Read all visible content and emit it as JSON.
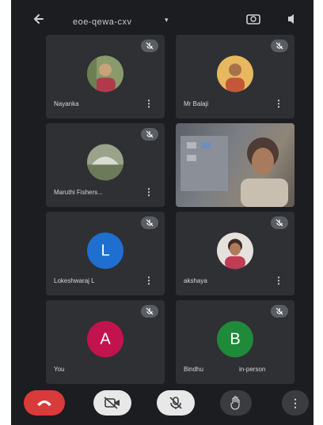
{
  "header": {
    "meeting_code": "eoe-qewa-cxv",
    "caret": "▾"
  },
  "participants": [
    {
      "name": "Nayanka",
      "type": "photo",
      "avatar_color": "#8a9a6a"
    },
    {
      "name": "Mr Balaji",
      "type": "photo",
      "avatar_color": "#d9a24a"
    },
    {
      "name": "Maruthi Fishers...",
      "type": "photo",
      "avatar_color": "#7f8c72"
    },
    {
      "name": "",
      "type": "video"
    },
    {
      "name": "Lokeshwaraj L",
      "type": "letter",
      "letter": "L",
      "avatar_color": "#1f6fd1"
    },
    {
      "name": "akshaya",
      "type": "photo",
      "avatar_color": "#c9b8b0"
    },
    {
      "name": "You",
      "type": "letter",
      "letter": "A",
      "avatar_color": "#c2134e"
    },
    {
      "name": "Bindhu",
      "type": "letter",
      "letter": "B",
      "avatar_color": "#1f8a3a",
      "extra": "in-person"
    }
  ],
  "controls": {
    "more": "⋮"
  },
  "colors": {
    "background": "#1c1d20",
    "tile": "#2e3034",
    "hangup": "#d93a3a"
  }
}
